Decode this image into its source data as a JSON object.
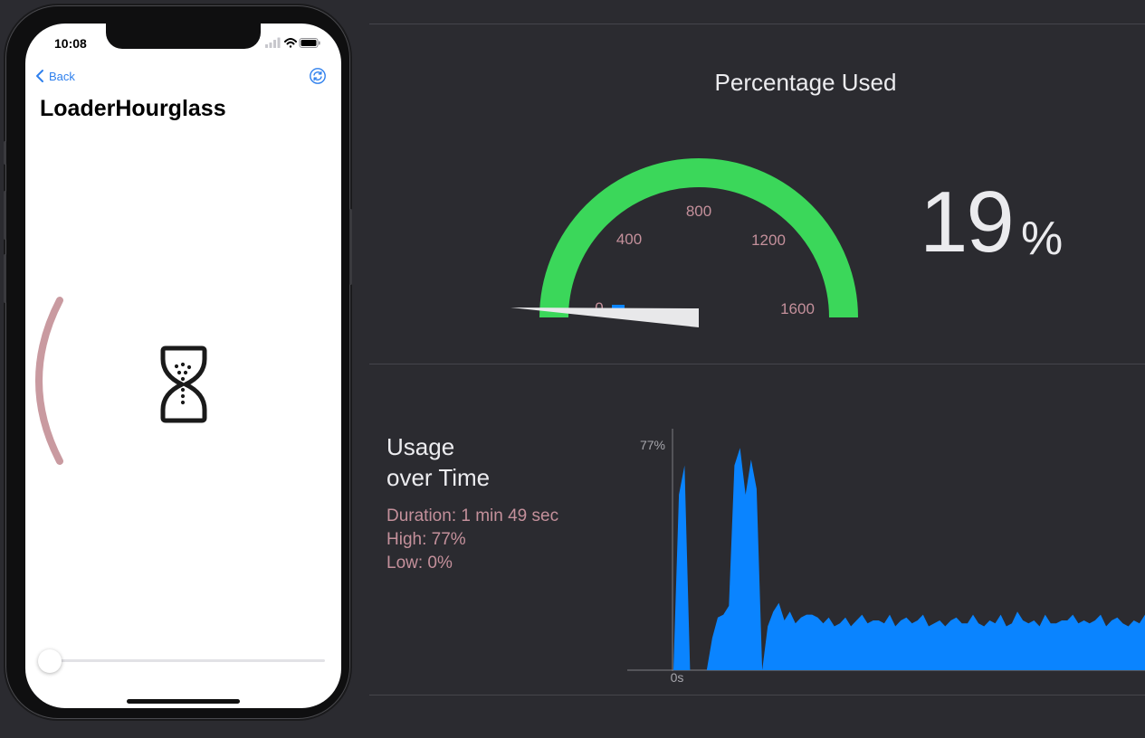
{
  "phone": {
    "status_time": "10:08",
    "nav_back_label": "Back",
    "page_title": "LoaderHourglass",
    "slider_value": 0.0
  },
  "gauge": {
    "title": "Percentage Used",
    "ticks": [
      "0",
      "400",
      "800",
      "1200",
      "1600"
    ],
    "percent_value": "19",
    "percent_unit": "%",
    "arc_color": "#3bd75a",
    "tick_color": "#c4909b"
  },
  "usage": {
    "title_line1": "Usage",
    "title_line2": "over Time",
    "duration": "Duration: 1 min 49 sec",
    "high": "High: 77%",
    "low": "Low: 0%",
    "chart_data": {
      "type": "area",
      "y_tick_label": "77%",
      "x_tick_label": "0s",
      "color": "#0a84ff",
      "ylim": [
        0,
        77
      ],
      "values": [
        0,
        60,
        70,
        0,
        0,
        0,
        0,
        11,
        18,
        19,
        22,
        70,
        76,
        60,
        72,
        62,
        0,
        15,
        20,
        23,
        17,
        20,
        16,
        18,
        19,
        19,
        18,
        16,
        18,
        15,
        16,
        18,
        15,
        17,
        19,
        16,
        17,
        17,
        16,
        19,
        15,
        17,
        18,
        16,
        17,
        19,
        15,
        16,
        17,
        15,
        17,
        18,
        16,
        16,
        19,
        16,
        15,
        17,
        16,
        19,
        15,
        16,
        20,
        17,
        16,
        17,
        15,
        19,
        16,
        16,
        17,
        17,
        19,
        16,
        17,
        16,
        17,
        19,
        15,
        17,
        18,
        16,
        15,
        17,
        16,
        19
      ]
    }
  }
}
